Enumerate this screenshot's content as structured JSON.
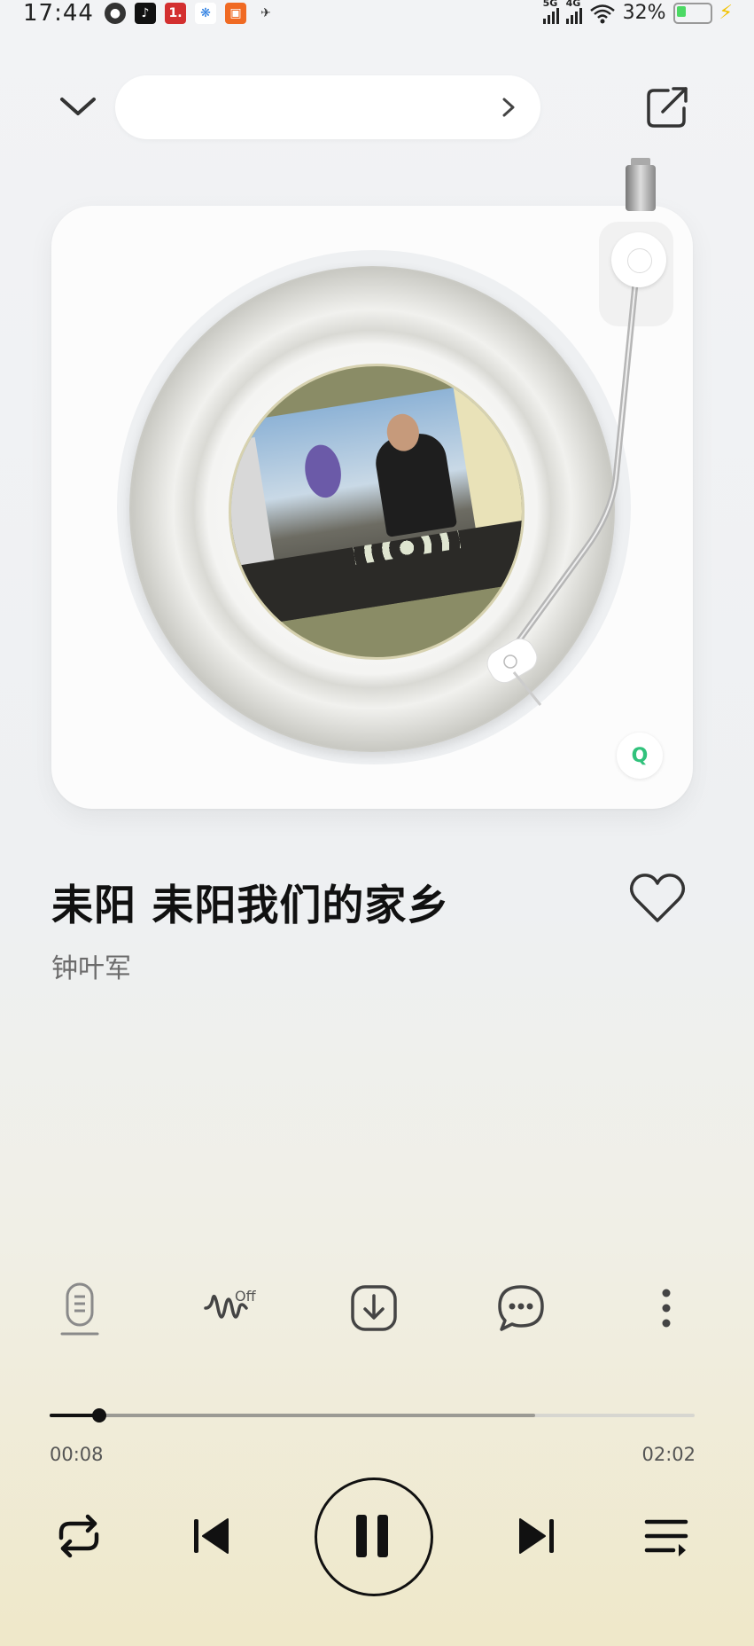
{
  "status_bar": {
    "time": "17:44",
    "network_1": "5G",
    "network_2": "4G",
    "battery": "32%",
    "battery_level": 0.32
  },
  "header": {
    "collapse_icon": "chevron-down-icon",
    "source_arrow_icon": "chevron-right-icon",
    "share_icon": "share-icon"
  },
  "player": {
    "song_title": "耒阳  耒阳我们的家乡",
    "artist": "钟叶军",
    "liked": false,
    "badge": "Q",
    "brand_color": "#31c27c"
  },
  "actions": {
    "sound_effect_label": "Off",
    "icons": [
      "lyrics-mic-icon",
      "sound-effect-icon",
      "download-icon",
      "comment-icon",
      "more-icon"
    ]
  },
  "progress": {
    "current": "00:08",
    "total": "02:02",
    "played_fraction": 0.077,
    "buffered_fraction": 0.753
  },
  "controls": {
    "icons": [
      "repeat-icon",
      "previous-icon",
      "pause-icon",
      "next-icon",
      "playlist-icon"
    ]
  }
}
